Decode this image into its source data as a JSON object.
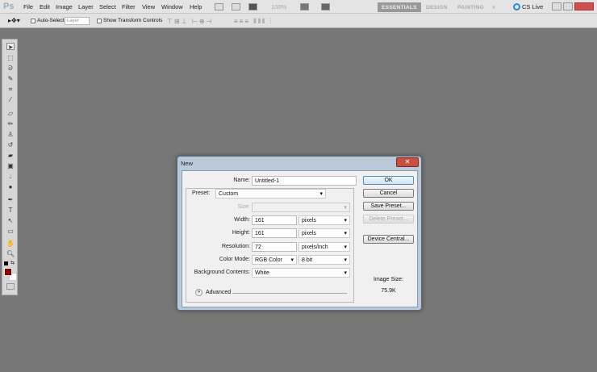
{
  "app": {
    "logo": "Ps"
  },
  "menu": [
    "File",
    "Edit",
    "Image",
    "Layer",
    "Select",
    "Filter",
    "View",
    "Window",
    "Help"
  ],
  "zoom_level": "100%",
  "workspaces": [
    "ESSENTIALS",
    "DESIGN",
    "PAINTING"
  ],
  "more_workspaces": "»",
  "cs_live": "CS Live",
  "options": {
    "auto_select_label": "Auto-Select:",
    "auto_select_value": "Layer",
    "show_transform": "Show Transform Controls"
  },
  "dialog": {
    "title": "New",
    "name_label": "Name:",
    "name_value": "Untitled-1",
    "preset_label": "Preset:",
    "preset_value": "Custom",
    "size_label": "Size:",
    "size_value": "",
    "width_label": "Width:",
    "width_value": "161",
    "width_unit": "pixels",
    "height_label": "Height:",
    "height_value": "161",
    "height_unit": "pixels",
    "resolution_label": "Resolution:",
    "resolution_value": "72",
    "resolution_unit": "pixels/inch",
    "color_mode_label": "Color Mode:",
    "color_mode_value": "RGB Color",
    "bit_depth": "8 bit",
    "background_label": "Background Contents:",
    "background_value": "White",
    "advanced_label": "Advanced",
    "buttons": {
      "ok": "OK",
      "cancel": "Cancel",
      "save_preset": "Save Preset...",
      "delete_preset": "Delete Preset...",
      "device_central": "Device Central..."
    },
    "image_size_label": "Image Size:",
    "image_size_value": "75.9K"
  },
  "colors": {
    "foreground": "#8b0000",
    "background": "#ffffff"
  }
}
